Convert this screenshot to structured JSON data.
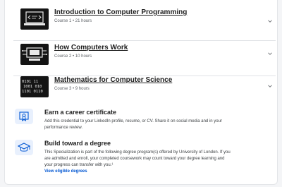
{
  "courses": [
    {
      "title": "Introduction to Computer Programming",
      "meta": "Course 1  •  21 hours",
      "thumb_icon": "laptop-code-thumbnail"
    },
    {
      "title": "How Computers Work",
      "meta": "Course 2  •  10 hours",
      "thumb_icon": "circuit-computer-thumbnail"
    },
    {
      "title": "Mathematics for Computer Science",
      "meta": "Course 3  •  9 hours",
      "thumb_icon": "binary-numbers-thumbnail"
    }
  ],
  "career": {
    "title": "Earn a career certificate",
    "desc": "Add this credential to your LinkedIn profile, resume, or CV. Share it on social media and in your performance review.",
    "icon": "certificate-icon"
  },
  "degree": {
    "title": "Build toward a degree",
    "desc": "This Specialization is part of the following degree program(s) offered by University of London. If you are admitted and enroll, your completed coursework may count toward your degree learning and your progress can transfer with you.¹",
    "link": "View eligible degrees",
    "icon": "graduation-cap-icon"
  },
  "colors": {
    "accent": "#0056d2",
    "icon_bg": "#e8f0fd"
  }
}
